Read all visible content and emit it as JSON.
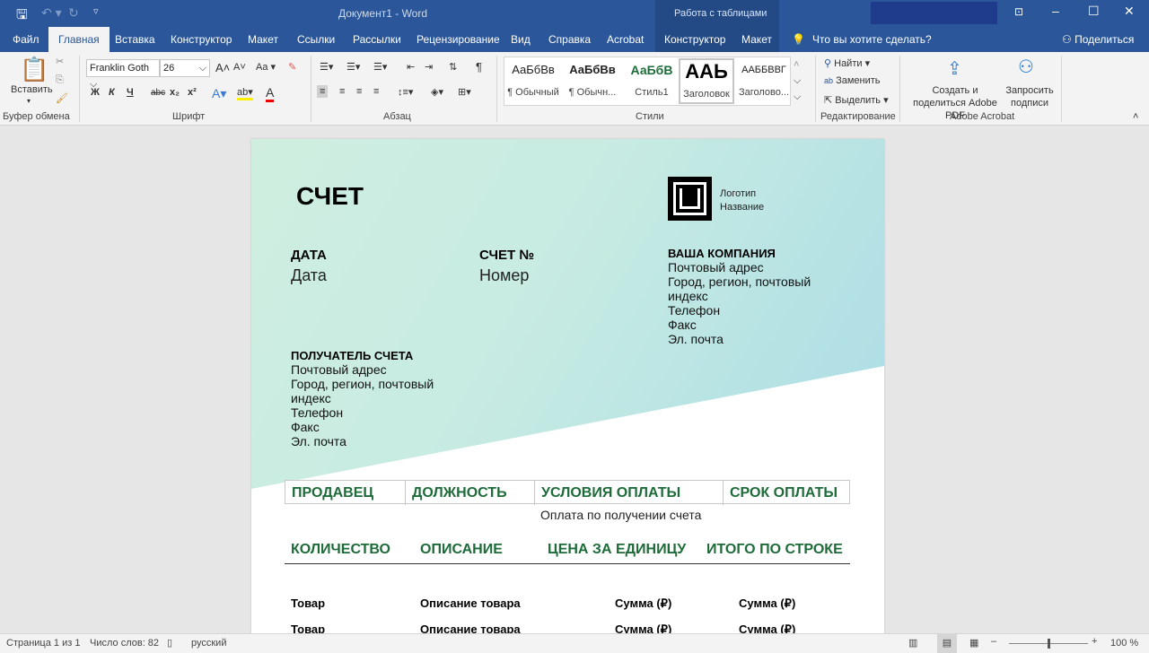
{
  "window": {
    "title": "Документ1 - Word",
    "context_tab_group": "Работа с таблицами"
  },
  "tabs": [
    "Файл",
    "Главная",
    "Вставка",
    "Конструктор",
    "Макет",
    "Ссылки",
    "Рассылки",
    "Рецензирование",
    "Вид",
    "Справка",
    "Acrobat",
    "Конструктор",
    "Макет"
  ],
  "tell_me": "Что вы хотите сделать?",
  "share": "Поделиться",
  "ribbon": {
    "clipboard": {
      "paste": "Вставить",
      "label": "Буфер обмена"
    },
    "font": {
      "name": "Franklin Goth",
      "size": "26",
      "label": "Шрифт",
      "bold": "Ж",
      "italic": "К",
      "underline": "Ч",
      "strike": "abc",
      "sub": "x₂",
      "sup": "x²",
      "case": "Aa"
    },
    "paragraph": {
      "label": "Абзац"
    },
    "styles": {
      "label": "Стили",
      "items": [
        {
          "preview": "АаБбВв",
          "name": "¶ Обычный"
        },
        {
          "preview": "АаБбВв",
          "name": "¶ Обычн..."
        },
        {
          "preview": "АаБбВ",
          "name": "Стиль1"
        },
        {
          "preview": "ААЬ",
          "name": "Заголовок"
        },
        {
          "preview": "ААББВВГ",
          "name": "Заголово..."
        }
      ]
    },
    "editing": {
      "label": "Редактирование",
      "find": "Найти",
      "replace": "Заменить",
      "select": "Выделить"
    },
    "acrobat": {
      "label": "Adobe Acrobat",
      "create": "Создать и поделиться Adobe PDF",
      "request": "Запросить подписи"
    }
  },
  "document": {
    "title": "СЧЕТ",
    "logo": {
      "line1": "Логотип",
      "line2": "Название"
    },
    "date_label": "ДАТА",
    "date_value": "Дата",
    "invoice_label": "СЧЕТ №",
    "invoice_value": "Номер",
    "company": {
      "label": "ВАША КОМПАНИЯ",
      "lines": [
        "Почтовый адрес",
        "Город, регион, почтовый",
        "индекс",
        "Телефон",
        "Факс",
        "Эл. почта"
      ]
    },
    "recipient": {
      "label": "ПОЛУЧАТЕЛЬ СЧЕТА",
      "lines": [
        "Почтовый адрес",
        "Город, регион, почтовый",
        "индекс",
        "Телефон",
        "Факс",
        "Эл. почта"
      ]
    },
    "terms_headers": [
      "ПРОДАВЕЦ",
      "ДОЛЖНОСТЬ",
      "УСЛОВИЯ ОПЛАТЫ",
      "СРОК ОПЛАТЫ"
    ],
    "terms_value": "Оплата по получении счета",
    "items_headers": [
      "КОЛИЧЕСТВО",
      "ОПИСАНИЕ",
      "ЦЕНА ЗА ЕДИНИЦУ",
      "ИТОГО ПО СТРОКЕ"
    ],
    "rows": [
      [
        "Товар",
        "Описание товара",
        "Сумма (₽)",
        "Сумма (₽)"
      ],
      [
        "Товар",
        "Описание товара",
        "Сумма (₽)",
        "Сумма (₽)"
      ]
    ],
    "accent_color": "#1e6b3a"
  },
  "status": {
    "page": "Страница 1 из 1",
    "words": "Число слов: 82",
    "language": "русский",
    "zoom": "100 %",
    "zoom_percent": 100
  }
}
